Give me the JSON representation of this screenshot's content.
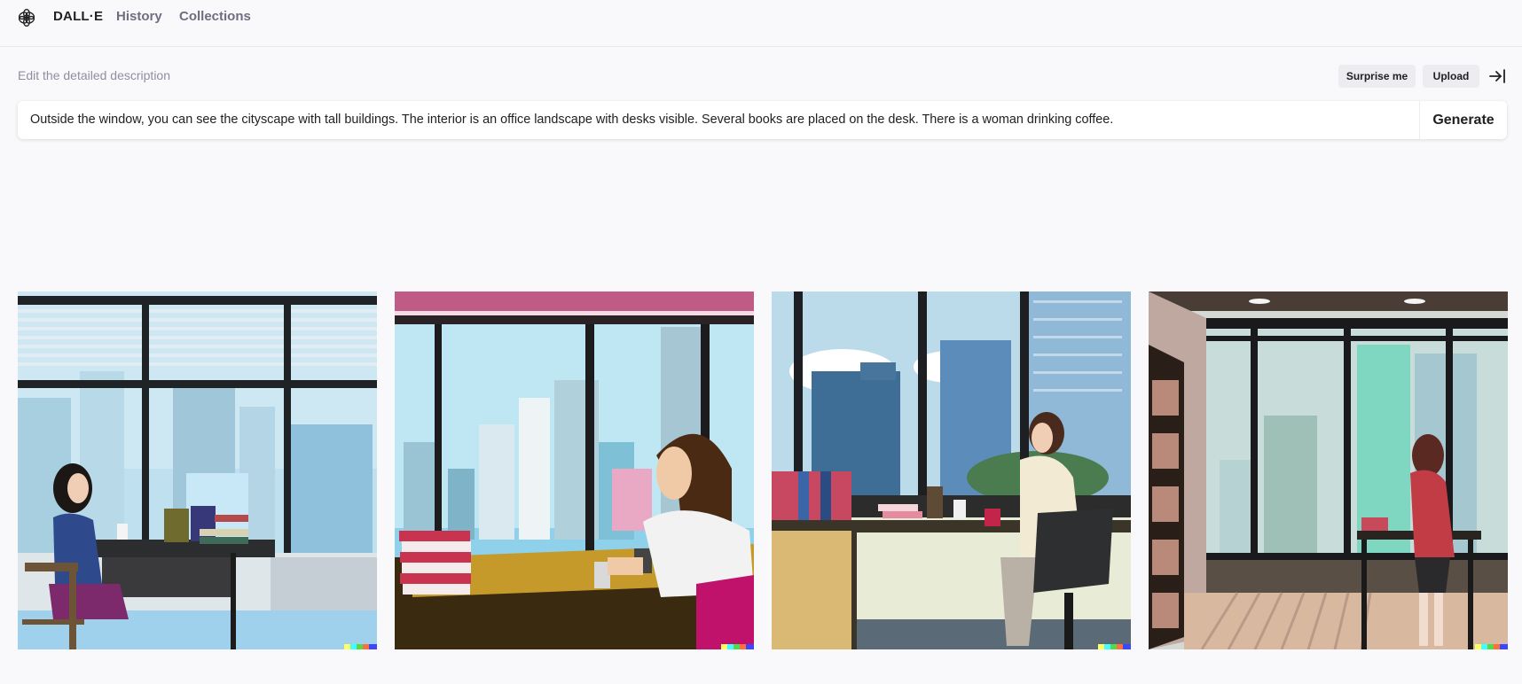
{
  "header": {
    "brand": "DALL·E",
    "nav": {
      "history": "History",
      "collections": "Collections"
    }
  },
  "prompt": {
    "label": "Edit the detailed description",
    "surprise_label": "Surprise me",
    "upload_label": "Upload",
    "text": "Outside the window, you can see the cityscape with tall buildings. The interior is an office landscape with desks visible. Several books are placed on the desk. There is a woman drinking coffee.",
    "generate_label": "Generate"
  },
  "icons": {
    "logo": "openai-logo-icon",
    "collapse": "collapse-panel-icon",
    "signature": "dalle-signature-icon"
  },
  "results": [
    {
      "description": "Woman at desk with coffee cup and books, blinds over city window"
    },
    {
      "description": "Woman with long hair holding coffee cup at desk with stack of books, city skyline"
    },
    {
      "description": "Woman in office chair at desk with books and coffee cups, city skyline"
    },
    {
      "description": "Woman standing at desk with bookshelf, city skyline through window"
    }
  ]
}
